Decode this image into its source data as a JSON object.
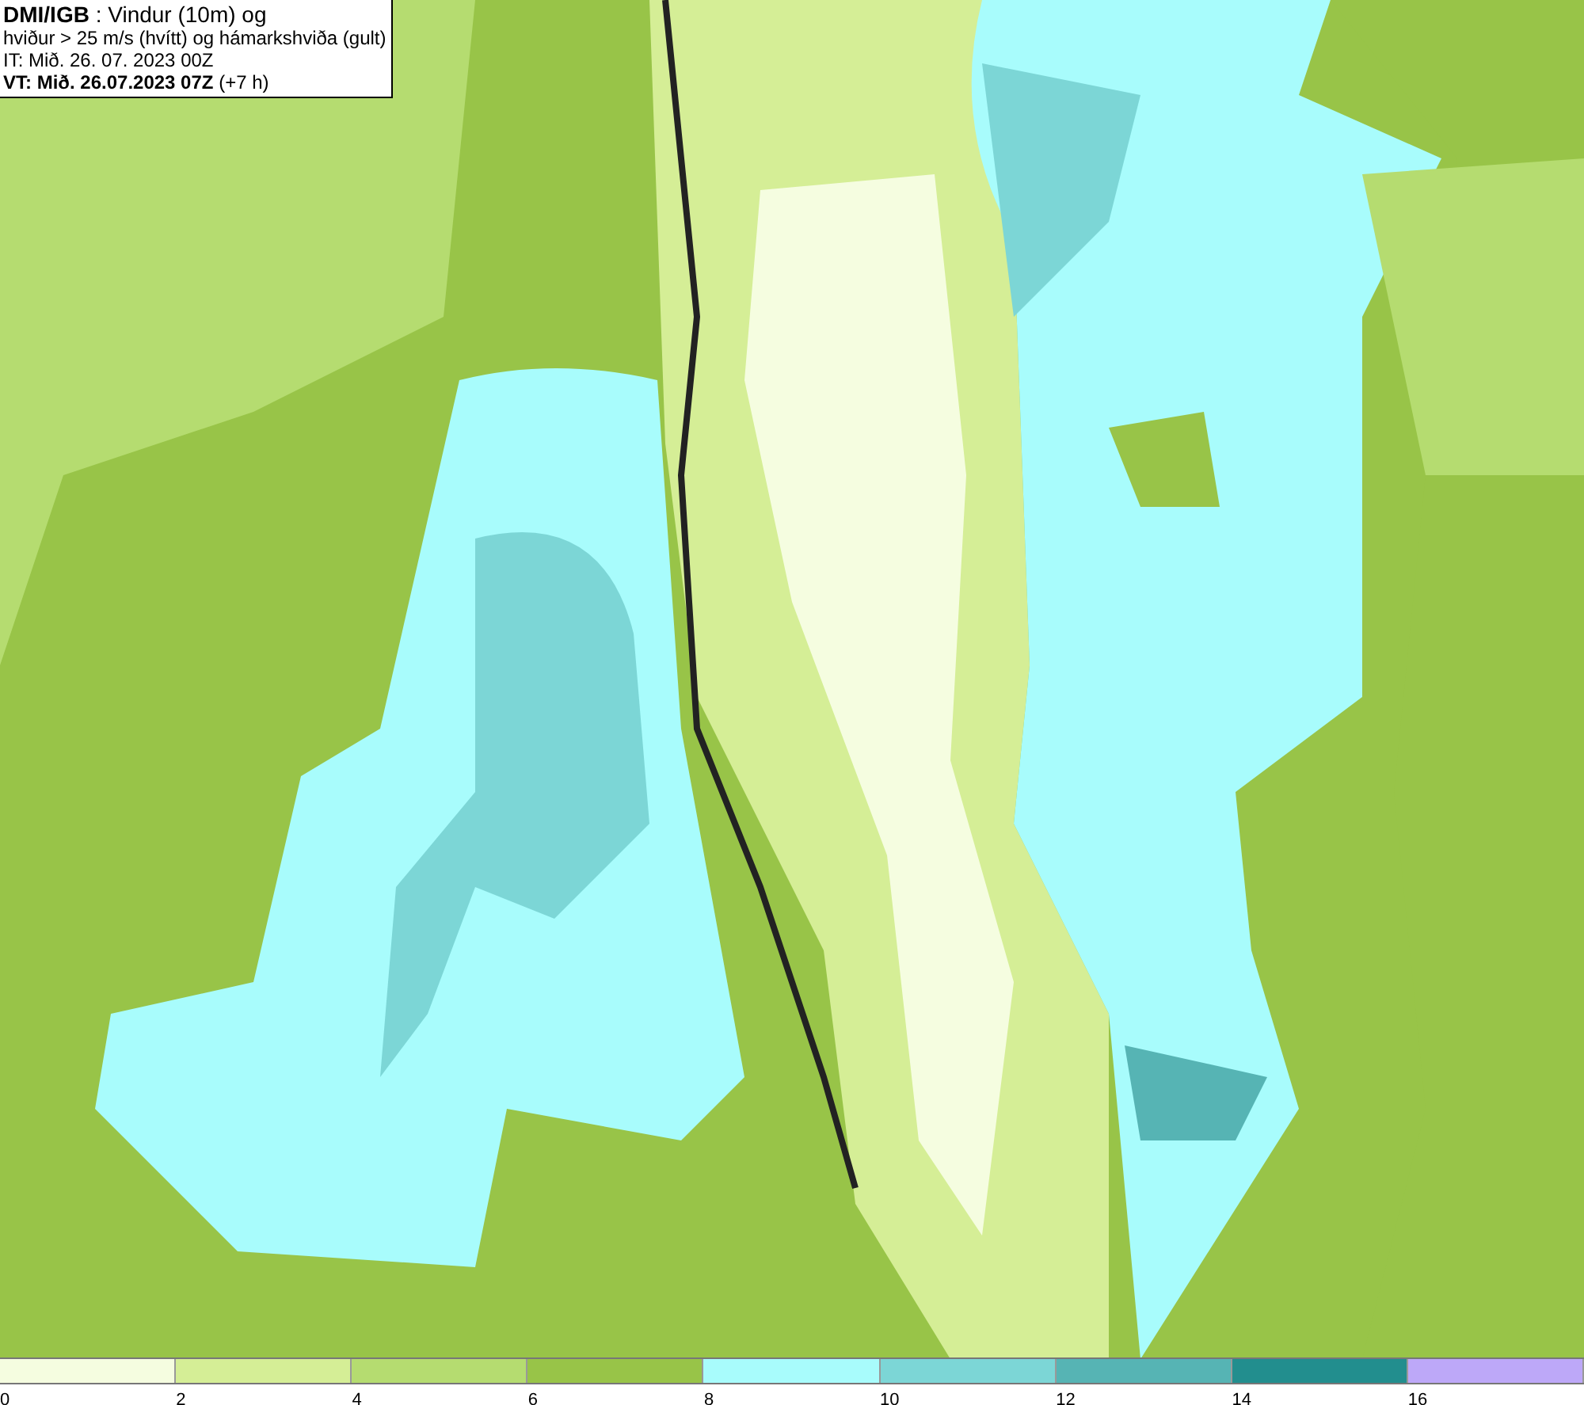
{
  "info_box": {
    "lines": [
      "**DMI/IGB** : Vindur (10m) og",
      "hviður > 25 m/s (hvítt) og hámarkshviða (gult)",
      "IT: Mið. 26. 07. 2023 00Z",
      "**VT: Mið. 26.07.2023 07Z** (+7 h)"
    ]
  },
  "legend": {
    "segments": [
      {
        "color": "#f5fde0",
        "label": "0"
      },
      {
        "color": "#d5ee96",
        "label": "2"
      },
      {
        "color": "#b5dc70",
        "label": "4"
      },
      {
        "color": "#98c448",
        "label": "6"
      },
      {
        "color": "#a8fcfc",
        "label": "8"
      },
      {
        "color": "#7cd6d6",
        "label": "10"
      },
      {
        "color": "#56b4b4",
        "label": "12"
      },
      {
        "color": "#228e8e",
        "label": "14"
      },
      {
        "color": "#bda8f8",
        "label": "16"
      }
    ]
  }
}
